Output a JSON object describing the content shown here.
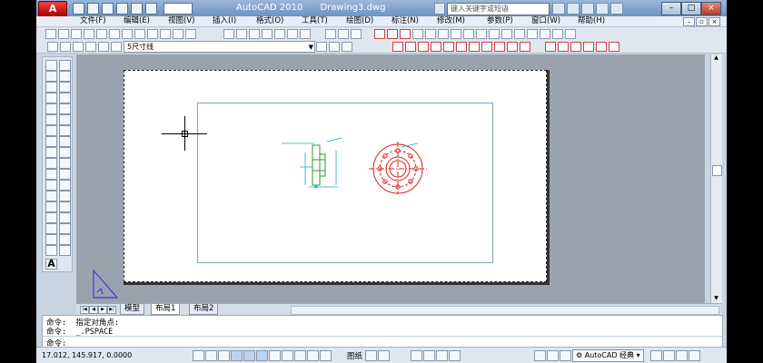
{
  "titlebar": {
    "logo": "A",
    "app_name": "AutoCAD 2010",
    "document": "Drawing3.dwg",
    "search_placeholder": "键入关键字或短语"
  },
  "menu": {
    "items": [
      "文件(F)",
      "编辑(E)",
      "视图(V)",
      "插入(I)",
      "格式(O)",
      "工具(T)",
      "绘图(D)",
      "标注(N)",
      "修改(M)",
      "参数(P)",
      "窗口(W)",
      "帮助(H)"
    ]
  },
  "layer_toolbar": {
    "current_layer": "5尺寸线"
  },
  "layout_tabs": {
    "tabs": [
      "模型",
      "布局1",
      "布局2"
    ],
    "active": "布局1"
  },
  "command_line": {
    "lines": [
      "命令:  指定对角点:",
      "命令:  _.PSPACE"
    ],
    "prompt": "命令:"
  },
  "status_bar": {
    "coordinates": "17.012,   145.917,   0.0000",
    "paper_label": "图纸",
    "workspace": "AutoCAD 经典"
  },
  "colors": {
    "titlebar": "#7fa0cc",
    "flange_red": "#e02020",
    "dimension_cyan": "#1fa8c8",
    "drawing_green": "#2c9a2c",
    "viewport_border": "#7ea2cc"
  }
}
